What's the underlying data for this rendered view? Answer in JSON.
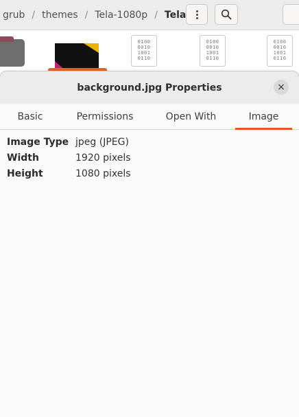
{
  "file_manager": {
    "breadcrumbs": [
      {
        "label": "grub"
      },
      {
        "label": "themes"
      },
      {
        "label": "Tela-1080p"
      },
      {
        "label": "Tela",
        "current": true
      }
    ],
    "binary_icon_text": [
      "0100",
      "0010",
      "1001",
      "0110"
    ]
  },
  "dialog": {
    "title": "background.jpg Properties",
    "close_icon": "×",
    "tabs": [
      {
        "label": "Basic",
        "active": false
      },
      {
        "label": "Permissions",
        "active": false
      },
      {
        "label": "Open With",
        "active": false
      },
      {
        "label": "Image",
        "active": true
      }
    ],
    "properties": [
      {
        "key": "Image Type",
        "value": "jpeg (JPEG)"
      },
      {
        "key": "Width",
        "value": "1920 pixels"
      },
      {
        "key": "Height",
        "value": "1080 pixels"
      }
    ]
  },
  "colors": {
    "accent": "#e95420"
  }
}
